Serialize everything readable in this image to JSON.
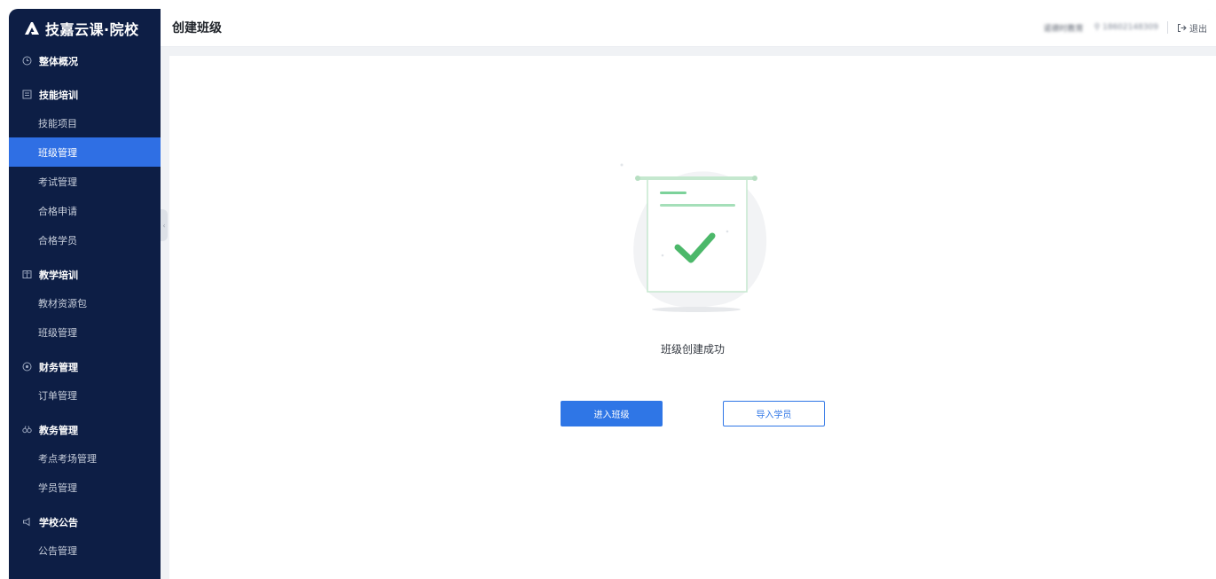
{
  "app": {
    "brand": "技嘉云课·院校"
  },
  "sidebar": {
    "groups": [
      {
        "label": "整体概况",
        "icon": "clock-icon",
        "items": []
      },
      {
        "label": "技能培训",
        "icon": "document-icon",
        "items": [
          {
            "label": "技能项目",
            "active": false
          },
          {
            "label": "班级管理",
            "active": true
          },
          {
            "label": "考试管理",
            "active": false
          },
          {
            "label": "合格申请",
            "active": false
          },
          {
            "label": "合格学员",
            "active": false
          }
        ]
      },
      {
        "label": "教学培训",
        "icon": "book-icon",
        "items": [
          {
            "label": "教材资源包",
            "active": false
          },
          {
            "label": "班级管理",
            "active": false
          }
        ]
      },
      {
        "label": "财务管理",
        "icon": "target-icon",
        "items": [
          {
            "label": "订单管理",
            "active": false
          }
        ]
      },
      {
        "label": "教务管理",
        "icon": "glasses-icon",
        "items": [
          {
            "label": "考点考场管理",
            "active": false
          },
          {
            "label": "学员管理",
            "active": false
          }
        ]
      },
      {
        "label": "学校公告",
        "icon": "megaphone-icon",
        "items": [
          {
            "label": "公告管理",
            "active": false
          }
        ]
      }
    ]
  },
  "header": {
    "title": "创建班级",
    "org": "诺德时教育",
    "user": "18602148309",
    "logout": "退出"
  },
  "main": {
    "success_text": "班级创建成功",
    "enter_class_button": "进入班级",
    "import_students_button": "导入学员"
  },
  "colors": {
    "sidebar_bg": "#0d1e45",
    "active_item": "#2f6fe4",
    "primary": "#2f76e6",
    "success_green": "#4cb86a"
  }
}
